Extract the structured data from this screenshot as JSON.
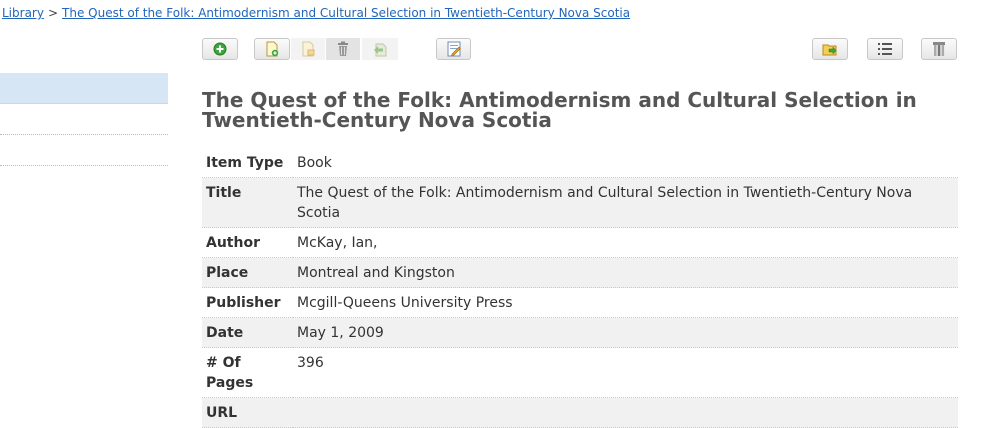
{
  "breadcrumb": {
    "root": "Library",
    "separator": ">",
    "current": "The Quest of the Folk: Antimodernism and Cultural Selection in Twentieth-Century Nova Scotia"
  },
  "toolbar": {
    "buttons": [
      "new-item-icon",
      "new-note-icon",
      "copy-icon",
      "trash-icon",
      "restore-icon",
      "edit-icon",
      "export-icon",
      "list-view-icon",
      "column-picker-icon"
    ],
    "accent": "#2a9d2a"
  },
  "item": {
    "title": "The Quest of the Folk: Antimodernism and Cultural Selection in Twentieth-Century Nova Scotia",
    "fields": [
      {
        "label": "Item Type",
        "value": "Book"
      },
      {
        "label": "Title",
        "value": "The Quest of the Folk: Antimodernism and Cultural Selection in Twentieth-Century Nova Scotia"
      },
      {
        "label": "Author",
        "value": "McKay, Ian,"
      },
      {
        "label": "Place",
        "value": "Montreal and Kingston"
      },
      {
        "label": "Publisher",
        "value": "Mcgill-Queens University Press"
      },
      {
        "label": "Date",
        "value": "May 1, 2009"
      },
      {
        "label": "# Of Pages",
        "value": "396"
      },
      {
        "label": "URL",
        "value": ""
      }
    ]
  },
  "colors": {
    "link": "#2266bb",
    "selected_row": "#d6e6f4",
    "title_text": "#555555"
  }
}
